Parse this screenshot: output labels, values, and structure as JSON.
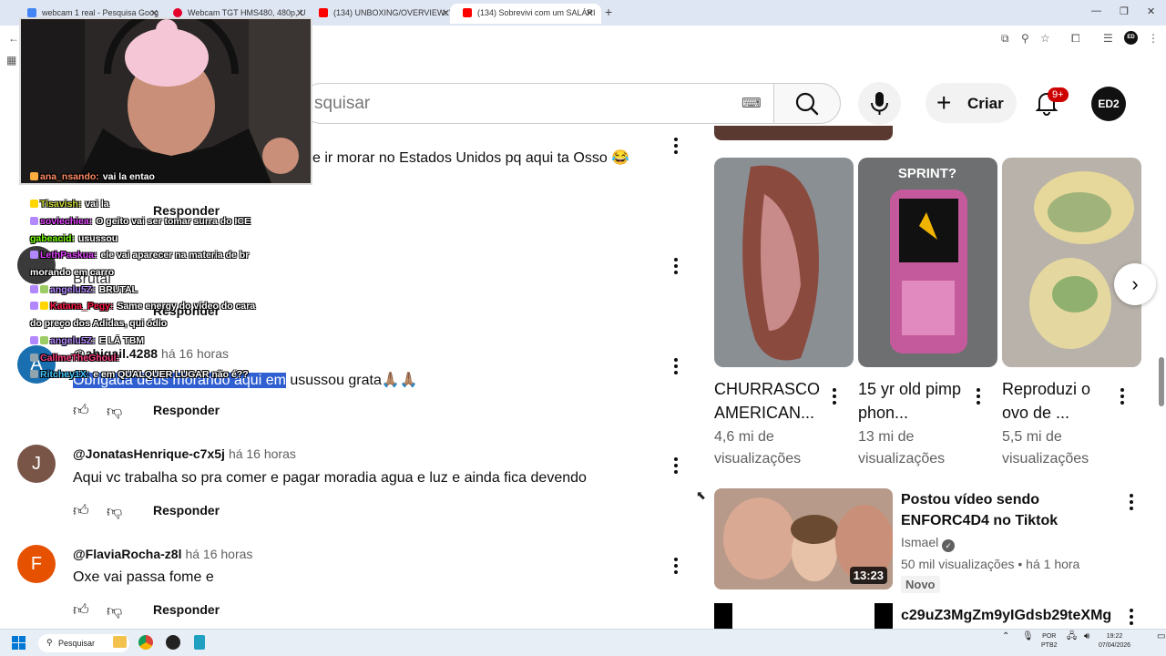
{
  "browser": {
    "tabs": [
      {
        "label": "webcam 1 real - Pesquisa Goog",
        "color": "#4285f4"
      },
      {
        "label": "Webcam TGT HMS480, 480p, U",
        "color": "#e4002b"
      },
      {
        "label": "(134) UNBOXING/OVERVIEW: W",
        "color": "#ff0000"
      },
      {
        "label": "(134) Sobrevivi com um SALÁRI",
        "color": "#ff0000"
      }
    ]
  },
  "header": {
    "search_placeholder": "Pesquisar",
    "search_visible": "squisar",
    "create_label": "Criar",
    "notif_count": "9+",
    "avatar_label": "ED2"
  },
  "comments": [
    {
      "text": "e ir morar no Estados Unidos pq aqui ta Osso 😂",
      "reply": "Responder"
    },
    {
      "author_partial": "@l...t...777",
      "text_partial": "Brutal",
      "reply": "Responder"
    },
    {
      "author": "@abigail.4288",
      "time": "há 16 horas",
      "text_selected": "Obrigada deus morando aqui em",
      "text_rest": " usussou grata🙏🏽🙏🏽",
      "reply": "Responder",
      "avatar_letter": "A",
      "avatar_color": "#1a6fb0"
    },
    {
      "author": "@JonatasHenrique-c7x5j",
      "time": "há 16 horas",
      "text": "Aqui vc trabalha so pra comer e pagar moradia agua e luz e ainda fica devendo",
      "reply": "Responder",
      "avatar_letter": "J",
      "avatar_color": "#795548"
    },
    {
      "author": "@FlaviaRocha-z8l",
      "time": "há 16 horas",
      "text": "Oxe vai passa fome e",
      "reply": "Responder",
      "avatar_letter": "F",
      "avatar_color": "#e65100"
    }
  ],
  "chat": [
    {
      "user": "ana_nsando:",
      "msg": "vai la entao",
      "color": "#ff8a65"
    },
    {
      "user": "Tisavish:",
      "msg": "vai la",
      "color": "#cddc39"
    },
    {
      "user": "soviechiea:",
      "msg": "O geito vai ser tomar surra do ICE",
      "color": "#e040fb"
    },
    {
      "user": "gabeacid:",
      "msg": "usussou",
      "color": "#76ff03"
    },
    {
      "user": "LethPaskua:",
      "msg": "ele vai aparecer na materia de br",
      "color": "#e040fb"
    },
    {
      "user": "",
      "msg": "morando em carro",
      "color": "#fff"
    },
    {
      "user": "angelu5Z:",
      "msg": "BRUTAL",
      "color": "#b388ff"
    },
    {
      "user": "Katana_Pegy:",
      "msg": "Same energy do vídeo do cara",
      "color": "#ff1744"
    },
    {
      "user": "",
      "msg": "do preço dos Adidas, qui ódio",
      "color": "#fff"
    },
    {
      "user": "angelu5Z:",
      "msg": "E LÁ TBM",
      "color": "#b388ff"
    },
    {
      "user": "CallmeTheGhoul:",
      "msg": "",
      "color": "#ff4081"
    },
    {
      "user": "Ritchey1X:",
      "msg": "e em QUALQUER LUGAR não é??",
      "color": "#40c4ff"
    }
  ],
  "shorts": [
    {
      "title": "CHURRASCO AMERICAN...",
      "views": "4,6 mi de visualizações",
      "overlay": ""
    },
    {
      "title": "15 yr old pimp phon...",
      "views": "13 mi de visualizações",
      "overlay": "SPRINT?"
    },
    {
      "title": "Reproduzi o ovo de ...",
      "views": "5,5 mi de visualizações",
      "overlay": ""
    }
  ],
  "videos": [
    {
      "title": "Postou vídeo sendo ENFORC4D4 no Tiktok",
      "channel": "Ismael",
      "meta": "50 mil visualizações • há 1 hora",
      "badge": "Novo",
      "duration": "13:23"
    },
    {
      "title": "c29uZ3MgZm9yIGdsb29teXMg",
      "channel": "",
      "meta": "",
      "badge": "",
      "duration": ""
    }
  ],
  "taskbar": {
    "search": "Pesquisar",
    "lang": "POR",
    "layout": "PTB2",
    "time": "19:22",
    "date": "07/04/2026"
  }
}
